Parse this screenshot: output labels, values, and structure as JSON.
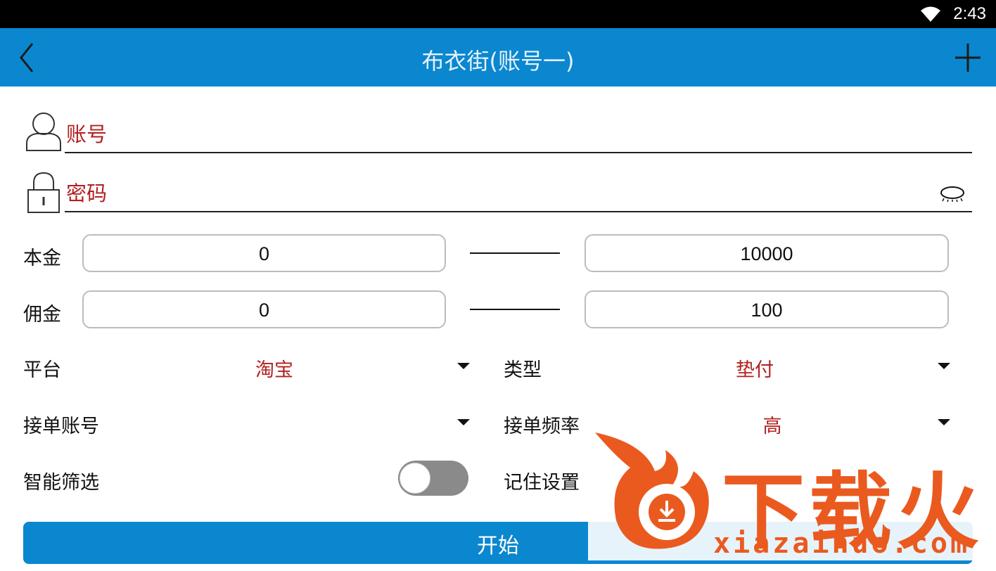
{
  "status_bar": {
    "time": "2:43",
    "wifi_icon": "wifi-icon"
  },
  "app_bar": {
    "title": "布衣街(账号一)",
    "back_icon": "chevron-left-icon",
    "add_icon": "plus-icon"
  },
  "login": {
    "account_placeholder": "账号",
    "password_placeholder": "密码",
    "account_icon": "user-icon",
    "password_icon": "lock-icon",
    "visibility_icon": "eye-closed-icon"
  },
  "ranges": {
    "principal": {
      "label": "本金",
      "min": "0",
      "max": "10000"
    },
    "commission": {
      "label": "佣金",
      "min": "0",
      "max": "100"
    }
  },
  "selects": {
    "platform": {
      "label": "平台",
      "value": "淘宝"
    },
    "type": {
      "label": "类型",
      "value": "垫付"
    },
    "order_account": {
      "label": "接单账号",
      "value": ""
    },
    "order_frequency": {
      "label": "接单频率",
      "value": "高"
    }
  },
  "toggles": {
    "smart_filter": {
      "label": "智能筛选",
      "on": false
    },
    "remember_settings": {
      "label": "记住设置"
    }
  },
  "submit": {
    "label": "开始"
  },
  "watermark": {
    "brand": "下载火",
    "url": "xiazaihuo.com"
  },
  "colors": {
    "accent": "#0a87cf",
    "value_red": "#b21f1f",
    "watermark_orange": "#ea5a1f"
  }
}
